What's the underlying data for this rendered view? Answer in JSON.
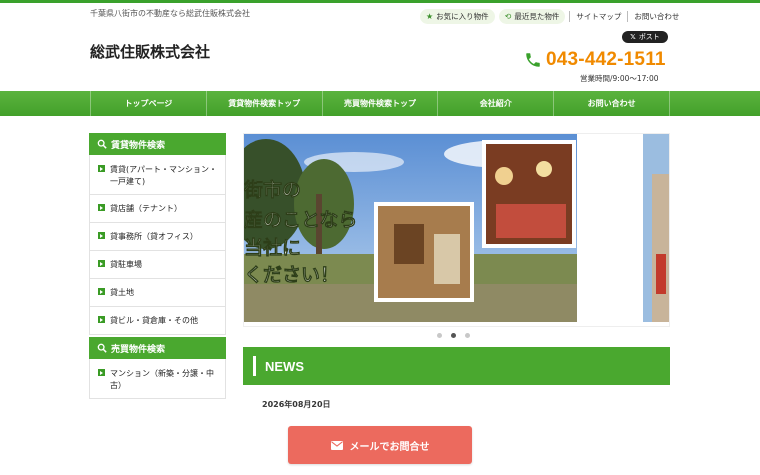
{
  "header": {
    "tagline": "千葉県八街市の不動産なら総武住販株式会社",
    "favorites_label": "お気に入り物件",
    "recent_label": "最近見た物件",
    "sitemap_label": "サイトマップ",
    "contact_label": "お問い合わせ",
    "company_name": "総武住販株式会社",
    "x_post_label": "ポスト",
    "phone_number": "043-442-1511",
    "business_hours": "営業時間/9:00～17:00"
  },
  "nav": {
    "items": [
      {
        "label": "トップページ"
      },
      {
        "label": "賃貸物件検索トップ"
      },
      {
        "label": "売買物件検索トップ"
      },
      {
        "label": "会社紹介"
      },
      {
        "label": "お問い合わせ"
      }
    ]
  },
  "sidebar": {
    "rental_heading": "賃貸物件検索",
    "rental_items": [
      {
        "label": "賃貸(アパート・マンション・一戸建て)"
      },
      {
        "label": "貸店舗（テナント）"
      },
      {
        "label": "貸事務所（貸オフィス）"
      },
      {
        "label": "貸駐車場"
      },
      {
        "label": "貸土地"
      },
      {
        "label": "貸ビル・貸倉庫・その他"
      }
    ],
    "sale_heading": "売買物件検索",
    "sale_items": [
      {
        "label": "マンション（新築・分譲・中古）"
      }
    ]
  },
  "slider": {
    "banner_lines": [
      "街市の",
      "産のことなら",
      "当社に",
      "ください！"
    ],
    "slide_count": 3,
    "active_index": 1
  },
  "news": {
    "title": "NEWS",
    "first_date": "2026年08月20日"
  },
  "cta": {
    "mail_label": "メールでお問合せ"
  },
  "colors": {
    "brand_green": "#4aa82f",
    "phone_orange": "#f08a00",
    "cta_red": "#ec6a5e"
  }
}
